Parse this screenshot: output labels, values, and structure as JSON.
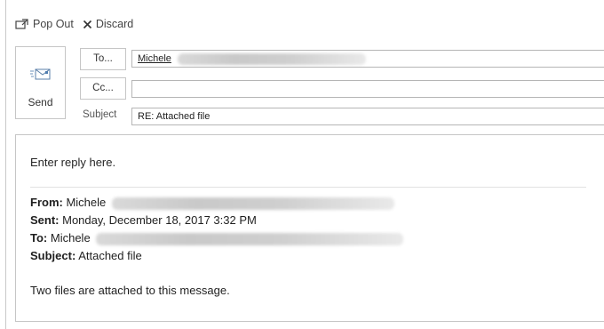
{
  "toolbar": {
    "pop_out_label": "Pop Out",
    "discard_label": "Discard",
    "pop_out_icon": "pop-out-icon",
    "discard_icon": "close-icon"
  },
  "compose": {
    "send_label": "Send",
    "send_icon": "envelope-send-icon",
    "to_button_label": "To...",
    "cc_button_label": "Cc...",
    "subject_label": "Subject",
    "to_value": "Michele",
    "cc_value": "",
    "subject_value": "RE: Attached file"
  },
  "body": {
    "reply_placeholder": "Enter reply here.",
    "quoted": {
      "from_label": "From:",
      "from_value": "Michele",
      "sent_label": "Sent:",
      "sent_value": "Monday, December 18, 2017 3:32 PM",
      "to_label": "To:",
      "to_value": "Michele",
      "subject_label": "Subject:",
      "subject_value": "Attached file",
      "message": "Two files are attached to this message."
    }
  },
  "colors": {
    "border": "#c6c6c6",
    "field_border": "#b5b5b5",
    "text": "#262626",
    "redaction": "#cfcfcf"
  }
}
